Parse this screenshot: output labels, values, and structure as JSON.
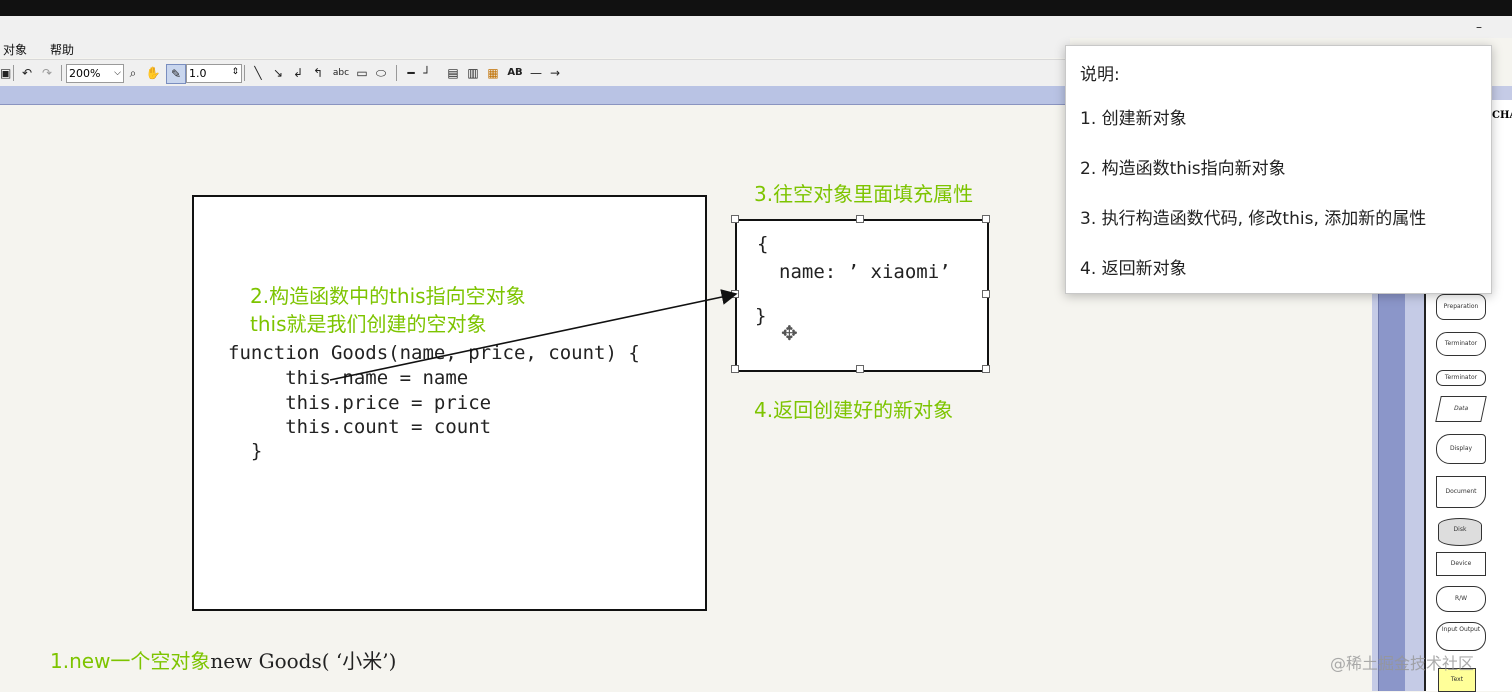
{
  "menu": {
    "object": "对象",
    "help": "帮助"
  },
  "toolbar": {
    "zoom": "200%",
    "line_width": "1.0",
    "abc_label": "abc",
    "ab_label": "AB"
  },
  "diagram": {
    "label_step3": "3.往空对象里面填充属性",
    "label_step2_line1": "2.构造函数中的this指向空对象",
    "label_step2_line2": "this就是我们创建的空对象",
    "label_step4": "4.返回创建好的新对象",
    "label_step1": "1.new一个空对象",
    "label_step1_code": "new Goods( ‘小米’)",
    "code_lines": [
      "function Goods(name, price, count) {",
      "     this.name = name",
      "     this.price = price",
      "     this.count = count",
      "  }"
    ],
    "obj_open": "{",
    "obj_prop": "name: ’ xiaomi’",
    "obj_close": "}"
  },
  "popup": {
    "title": "说明:",
    "items": [
      "1. 创建新对象",
      "2. 构造函数this指向新对象",
      "3. 执行构造函数代码, 修改this, 添加新的属性",
      "4. 返回新对象"
    ]
  },
  "side_panel": {
    "heading": "CHAR",
    "shapes": [
      "Preparation",
      "Terminator",
      "Terminator",
      "Data",
      "Display",
      "Document",
      "Disk",
      "Device",
      "R/W",
      "Input Output",
      "Text"
    ]
  },
  "watermark": "@稀土掘金技术社区",
  "colors": {
    "accent_green": "#7dc400",
    "toolbar_band": "#b9c3e4"
  }
}
